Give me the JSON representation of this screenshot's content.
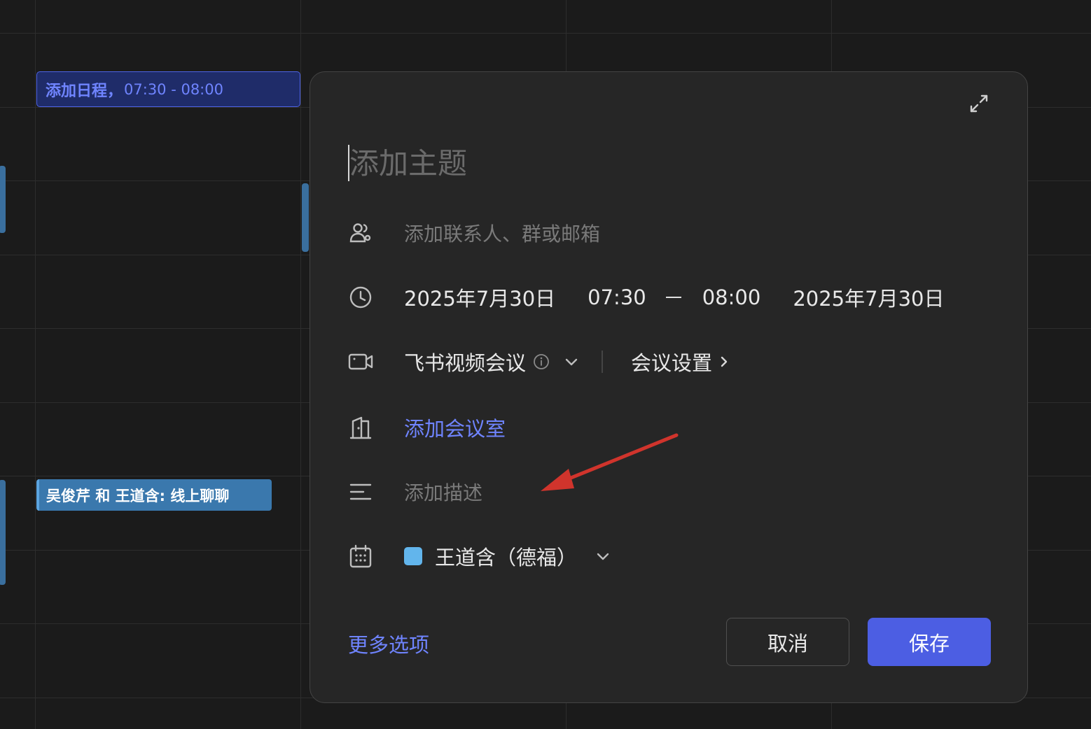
{
  "calendar": {
    "new_event": {
      "title": "添加日程，",
      "time": "07:30 - 08:00"
    },
    "chat_event": {
      "title": "吴俊芹 和 王道含: 线上聊聊"
    }
  },
  "dialog": {
    "subject_placeholder": "添加主题",
    "attendees_placeholder": "添加联系人、群或邮箱",
    "datetime": {
      "start_date": "2025年7月30日",
      "start_time": "07:30",
      "end_time": "08:00",
      "end_date": "2025年7月30日"
    },
    "video_meeting": {
      "label": "飞书视频会议",
      "settings_label": "会议设置"
    },
    "room_label": "添加会议室",
    "description_placeholder": "添加描述",
    "calendar_owner": "王道含（德福）",
    "more_options_label": "更多选项",
    "cancel_label": "取消",
    "save_label": "保存"
  },
  "icons": {
    "expand": "expand-icon",
    "attendees": "people-icon",
    "time": "clock-icon",
    "video": "video-camera-icon",
    "room": "door-icon",
    "description": "text-lines-icon",
    "calendar": "calendar-icon"
  },
  "colors": {
    "accent": "#4c5ee3",
    "link": "#6f84ff",
    "calendar_swatch": "#62b5ec",
    "annotation_arrow": "#d0342c"
  }
}
